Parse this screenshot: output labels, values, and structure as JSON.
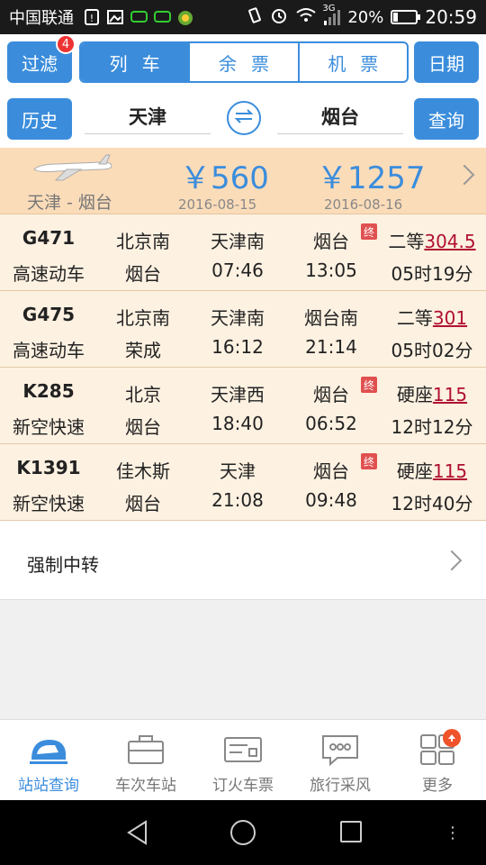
{
  "status_bar": {
    "carrier": "中国联通",
    "network": "3G",
    "battery": "20%",
    "battery_level": 0.2,
    "time": "20:59"
  },
  "header": {
    "filter_label": "过滤",
    "filter_badge": "4",
    "segments": [
      {
        "label": "列车",
        "active": true
      },
      {
        "label": "余票",
        "active": false
      },
      {
        "label": "机票",
        "active": false
      }
    ],
    "date_label": "日期",
    "history_label": "历史",
    "from_city": "天津",
    "to_city": "烟台",
    "query_label": "查询"
  },
  "flight": {
    "route": "天津 - 烟台",
    "price1": "￥560",
    "date1": "2016-08-15",
    "price2": "￥1257",
    "date2": "2016-08-16"
  },
  "trains": [
    {
      "code": "G471",
      "type": "高速动车",
      "from": "北京南",
      "to": "烟台",
      "dep_station": "天津南",
      "dep_time": "07:46",
      "arr_station": "烟台",
      "arr_time": "13:05",
      "terminal": true,
      "terminal_label": "终",
      "seat": "二等",
      "price": "304.5",
      "duration": "05时19分"
    },
    {
      "code": "G475",
      "type": "高速动车",
      "from": "北京南",
      "to": "荣成",
      "dep_station": "天津南",
      "dep_time": "16:12",
      "arr_station": "烟台南",
      "arr_time": "21:14",
      "terminal": false,
      "terminal_label": "",
      "seat": "二等",
      "price": "301",
      "duration": "05时02分"
    },
    {
      "code": "K285",
      "type": "新空快速",
      "from": "北京",
      "to": "烟台",
      "dep_station": "天津西",
      "dep_time": "18:40",
      "arr_station": "烟台",
      "arr_time": "06:52",
      "terminal": true,
      "terminal_label": "终",
      "seat": "硬座",
      "price": "115",
      "duration": "12时12分"
    },
    {
      "code": "K1391",
      "type": "新空快速",
      "from": "佳木斯",
      "to": "烟台",
      "dep_station": "天津",
      "dep_time": "21:08",
      "arr_station": "烟台",
      "arr_time": "09:48",
      "terminal": true,
      "terminal_label": "终",
      "seat": "硬座",
      "price": "115",
      "duration": "12时40分"
    }
  ],
  "transfer": {
    "label": "强制中转"
  },
  "tabs": [
    {
      "label": "站站查询",
      "icon": "train-icon",
      "active": true
    },
    {
      "label": "车次车站",
      "icon": "briefcase-icon",
      "active": false
    },
    {
      "label": "订火车票",
      "icon": "ticket-icon",
      "active": false
    },
    {
      "label": "旅行采风",
      "icon": "chat-icon",
      "active": false
    },
    {
      "label": "更多",
      "icon": "grid-icon",
      "active": false
    }
  ],
  "colors": {
    "accent": "#3b8ddc",
    "flight_bg": "#fbdcb9",
    "train_bg": "#fdf1e1",
    "price": "#b01030"
  }
}
